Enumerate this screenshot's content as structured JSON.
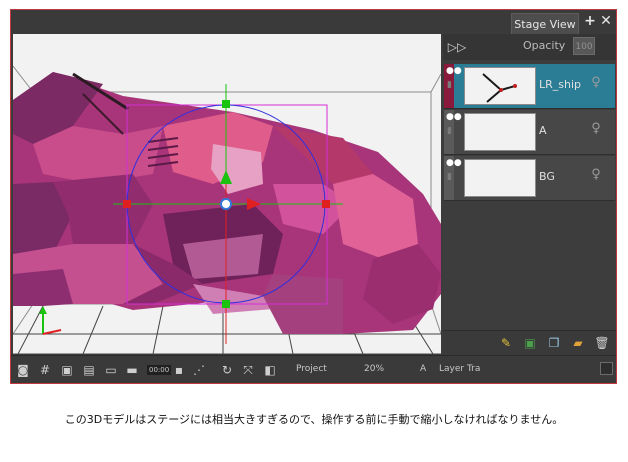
{
  "window": {
    "tab_title": "Stage View",
    "add_icon": "plus-icon",
    "close_icon": "close-icon"
  },
  "colors": {
    "selected_layer": "#2b7d95",
    "layer_color_tag": "#8a1a3b",
    "frame_border": "#c0393e",
    "bounding_box": "#d42fd6",
    "handle_green": "#19c30e",
    "handle_red": "#e02020",
    "ring_blue": "#2f2fe0"
  },
  "layers_panel": {
    "collapse_icon": "double-chevron-right-icon",
    "opacity_label": "Opacity",
    "opacity_value": "100",
    "layers": [
      {
        "name": "LR_ship",
        "selected": true,
        "icons": [
          "eye-icon",
          "lock-icon",
          "peg-icon"
        ]
      },
      {
        "name": "A",
        "selected": false,
        "icons": [
          "eye-icon",
          "lock-icon",
          "peg-icon"
        ]
      },
      {
        "name": "BG",
        "selected": false,
        "icons": [
          "eye-icon",
          "lock-icon",
          "peg-icon"
        ]
      }
    ],
    "footer_icons": [
      "add-drawing-layer-icon",
      "add-image-layer-icon",
      "duplicate-layer-icon",
      "add-folder-icon",
      "delete-layer-icon"
    ]
  },
  "status_bar": {
    "icons": [
      "camera-icon",
      "grid-icon",
      "safe-area-icon",
      "field-guide-icon",
      "onion-skin-icon",
      "camera-mask-icon",
      "timecode-icon",
      "frame-icon",
      "motion-path-icon",
      "reset-rotation-icon",
      "reset-zoom-icon",
      "render-icon"
    ],
    "timecode_label": "00:00",
    "view_mode": "Project",
    "zoom": "20%",
    "layer_indicator": "A",
    "layer_transform": "Layer Tra"
  },
  "caption": "この3Dモデルはステージには相当大きすぎるので、操作する前に手動で縮小しなければなりません。"
}
